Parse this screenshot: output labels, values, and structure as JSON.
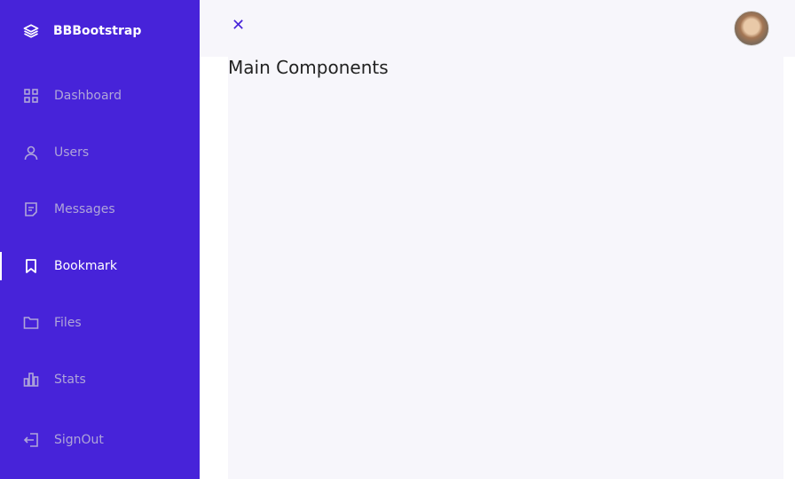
{
  "brand": {
    "name": "BBBootstrap",
    "icon": "layers-icon"
  },
  "nav": [
    {
      "label": "Dashboard",
      "icon": "grid-icon",
      "active": false
    },
    {
      "label": "Users",
      "icon": "user-icon",
      "active": false
    },
    {
      "label": "Messages",
      "icon": "message-icon",
      "active": false
    },
    {
      "label": "Bookmark",
      "icon": "bookmark-icon",
      "active": true
    },
    {
      "label": "Files",
      "icon": "folder-icon",
      "active": false
    },
    {
      "label": "Stats",
      "icon": "bar-chart-icon",
      "active": false
    }
  ],
  "signout": {
    "label": "SignOut",
    "icon": "signout-icon"
  },
  "header": {
    "close_glyph": "✕"
  },
  "main": {
    "title": "Main Components"
  },
  "colors": {
    "sidebar": "#4723D9",
    "inactive": "#AFA5D9",
    "background": "#F7F6FB"
  }
}
